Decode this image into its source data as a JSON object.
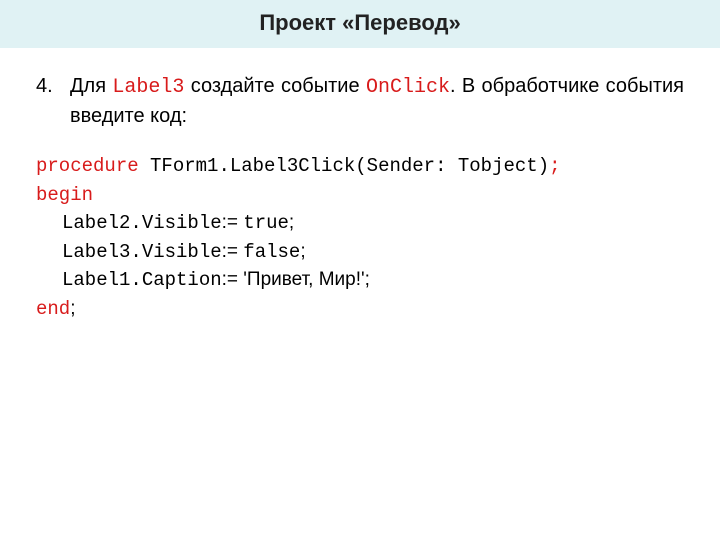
{
  "title": "Проект «Перевод»",
  "instruction": {
    "num": "4.",
    "pre": "Для ",
    "label3": "Label3",
    "mid": " создайте событие ",
    "onclick": "OnClick",
    "post": ". В обработчике события введите код:"
  },
  "code": {
    "l1a": "procedure",
    "l1b": " TForm1.Label3Click(Sender: Tobject)",
    "l1c": ";",
    "l2": "begin",
    "l3a": "Label2.Visible",
    "l3b": ":= ",
    "l3c": "true",
    "l3d": ";",
    "l4a": "Label3.Visible",
    "l4b": ":= ",
    "l4c": "false",
    "l4d": ";",
    "l5a": "Label1.Caption",
    "l5b": ":= ",
    "l5c": "'Привет, Мир!';",
    "l6a": "end",
    "l6b": ";"
  }
}
